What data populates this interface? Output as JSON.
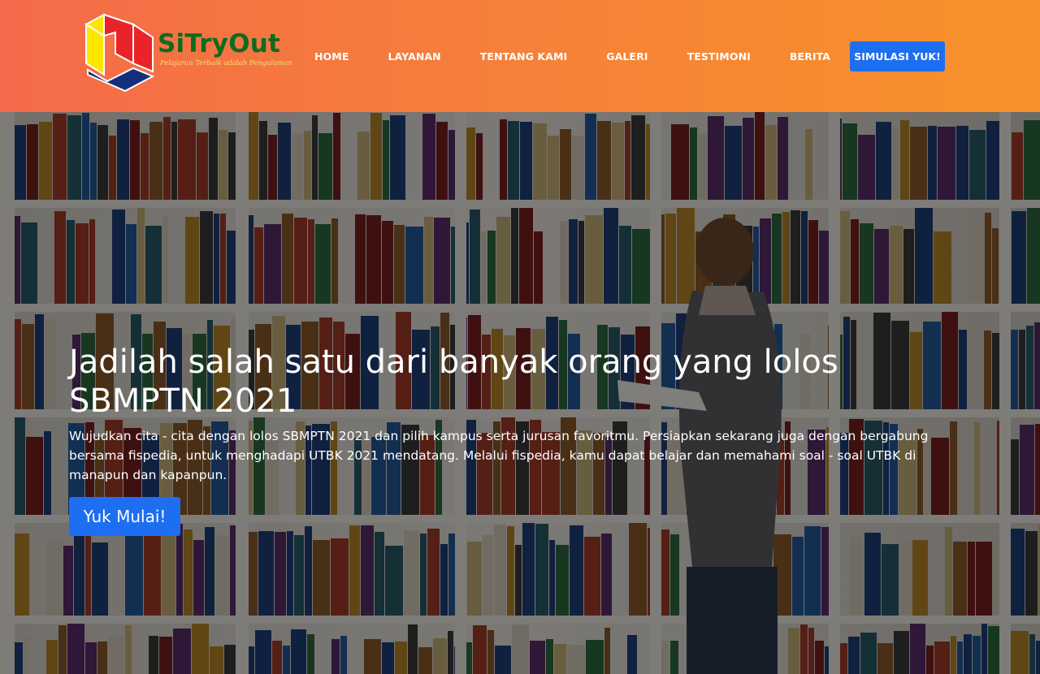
{
  "brand": {
    "name": "SiTryOut",
    "tagline": "Pelajaran Terbaik adalah Pengalaman",
    "logo_icon": "cube-logo-icon"
  },
  "nav": {
    "items": [
      {
        "label": "HOME"
      },
      {
        "label": "LAYANAN"
      },
      {
        "label": "TENTANG KAMI"
      },
      {
        "label": "GALERI"
      },
      {
        "label": "TESTIMONI"
      },
      {
        "label": "BERITA"
      }
    ],
    "cta_label": "SIMULASI YUK!"
  },
  "hero": {
    "title": "Jadilah salah satu dari banyak orang yang lolos SBMPTN 2021",
    "description": "Wujudkan cita - cita dengan lolos SBMPTN 2021 dan pilih kampus serta jurusan favoritmu. Persiapkan sekarang juga dengan bergabung bersama fispedia, untuk menghadapi UTBK 2021 mendatang. Melalui fispedia, kamu dapat belajar dan memahami soal - soal UTBK di manapun dan kapanpun.",
    "button_label": "Yuk Mulai!",
    "background_image": "library-bookshelves-photo"
  },
  "colors": {
    "header_gradient_start": "#f56a4a",
    "header_gradient_end": "#f7922a",
    "accent_blue": "#1e6ef2",
    "logo_green": "#0f6b1e",
    "logo_yellow": "#ffe600",
    "logo_red": "#e8242a",
    "logo_navy": "#14307a"
  }
}
